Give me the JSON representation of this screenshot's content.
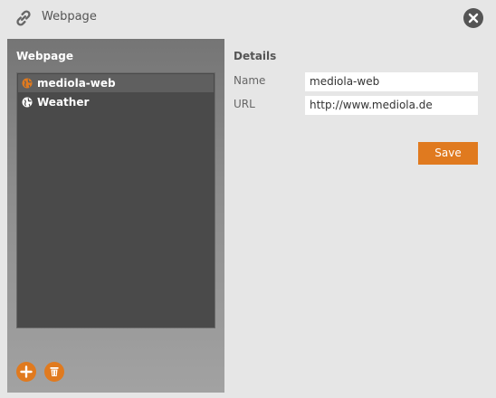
{
  "window": {
    "title": "Webpage",
    "title_icon": "link-icon",
    "close_icon": "close-icon"
  },
  "sidebar": {
    "heading": "Webpage",
    "items": [
      {
        "label": "mediola-web",
        "icon": "globe-icon",
        "selected": true,
        "icon_color": "#e07a1f"
      },
      {
        "label": "Weather",
        "icon": "globe-icon",
        "selected": false,
        "icon_color": "#ffffff"
      }
    ],
    "add_icon": "plus-icon",
    "delete_icon": "trash-icon"
  },
  "details": {
    "heading": "Details",
    "name_label": "Name",
    "name_value": "mediola-web",
    "url_label": "URL",
    "url_value": "http://www.mediola.de",
    "save_label": "Save"
  },
  "colors": {
    "accent": "#e07a1f",
    "background": "#e6e6e6",
    "list_background": "#4a4a4a"
  }
}
